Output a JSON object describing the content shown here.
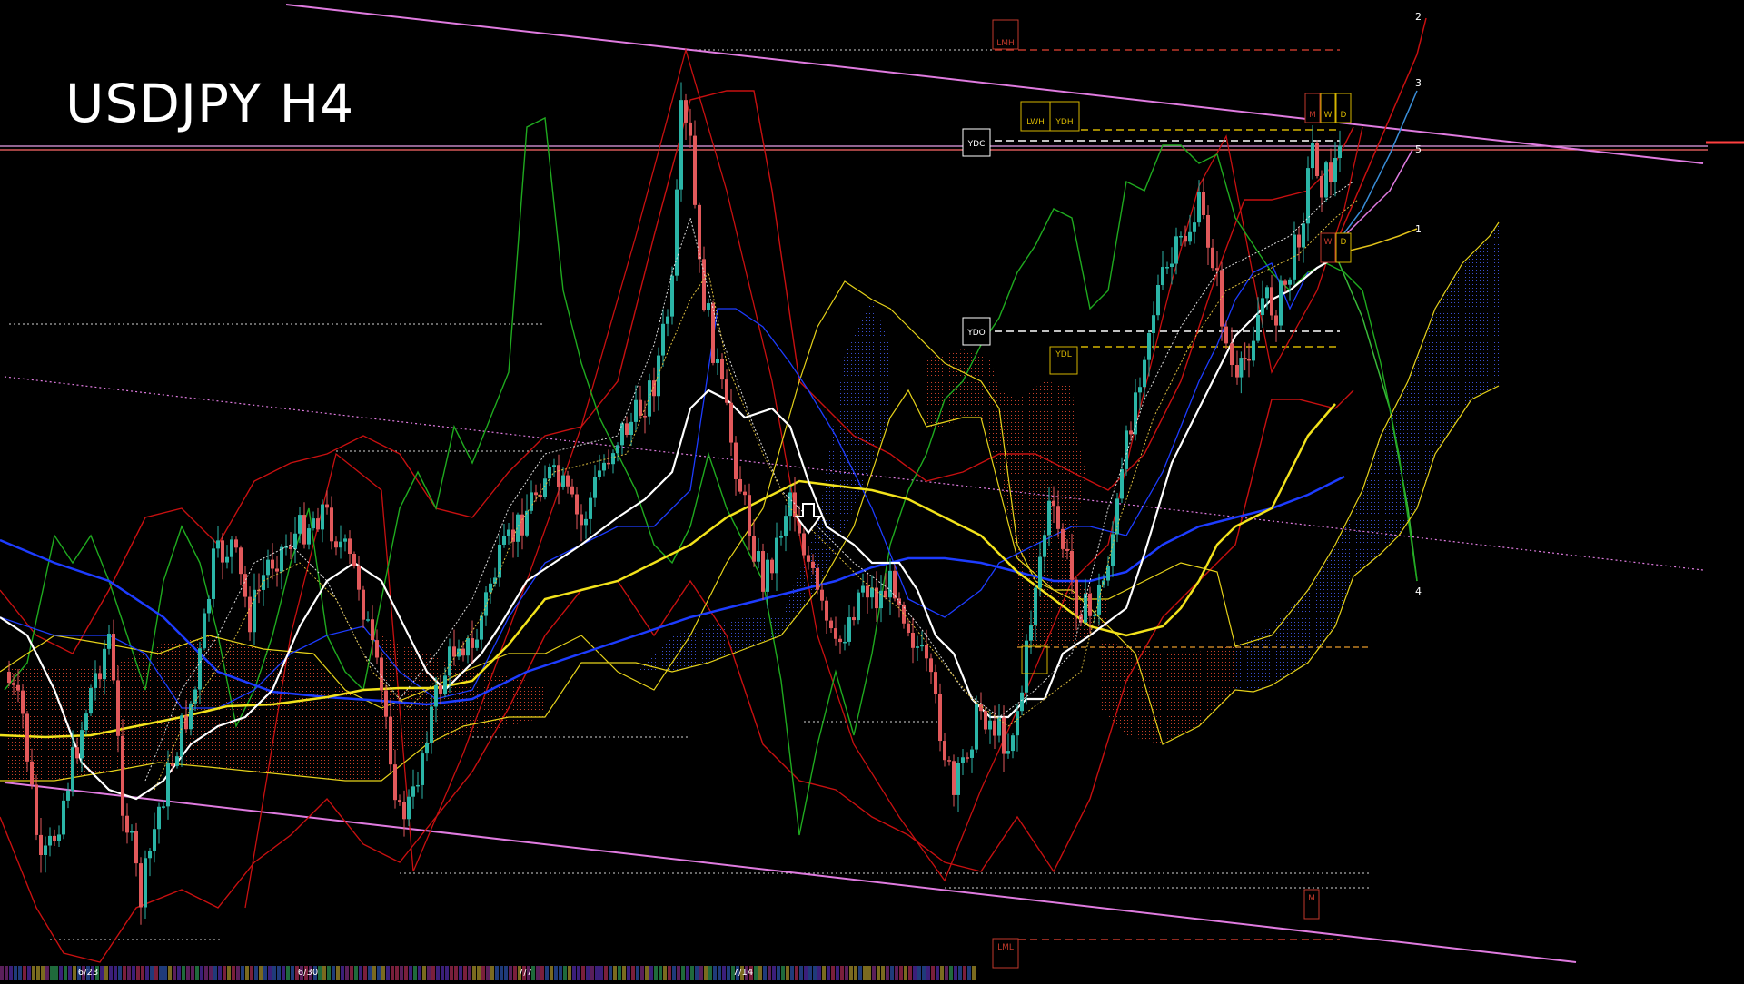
{
  "chart_data": {
    "type": "candlestick",
    "title": "USDJPY H4",
    "date_labels": [
      "6/23",
      "6/30",
      "7/7",
      "7/14"
    ],
    "price_levels": [
      {
        "label": "LMH",
        "color": "#c0392b"
      },
      {
        "label": "LWH",
        "color": "#d4b400"
      },
      {
        "label": "YDH",
        "color": "#d4b400"
      },
      {
        "label": "YDC",
        "color": "#ffffff"
      },
      {
        "label": "YDO",
        "color": "#ffffff"
      },
      {
        "label": "YDL",
        "color": "#d4b400"
      },
      {
        "label": "LML",
        "color": "#c0392b"
      }
    ],
    "corner_markers": {
      "top_red": [
        "M"
      ],
      "top_yellow": [
        "W",
        "D"
      ],
      "mid_red": [
        "W"
      ],
      "mid_yellow": [
        "D"
      ],
      "bottom_red": [
        "M"
      ]
    },
    "projection_labels": [
      "2",
      "3",
      "5",
      "1",
      "4"
    ],
    "colors": {
      "background": "#000000",
      "bull": "#2bb5a7",
      "bear": "#e2595b",
      "channel": "#e07be0",
      "sma_white": "#ffffff",
      "sma_yellow": "#f2e21b",
      "sma_blue": "#1d3cff",
      "chikou": "#1faa1f",
      "bollinger": "#c81010",
      "kumo_bull": "#3548b8",
      "kumo_bear": "#b8321f"
    }
  }
}
